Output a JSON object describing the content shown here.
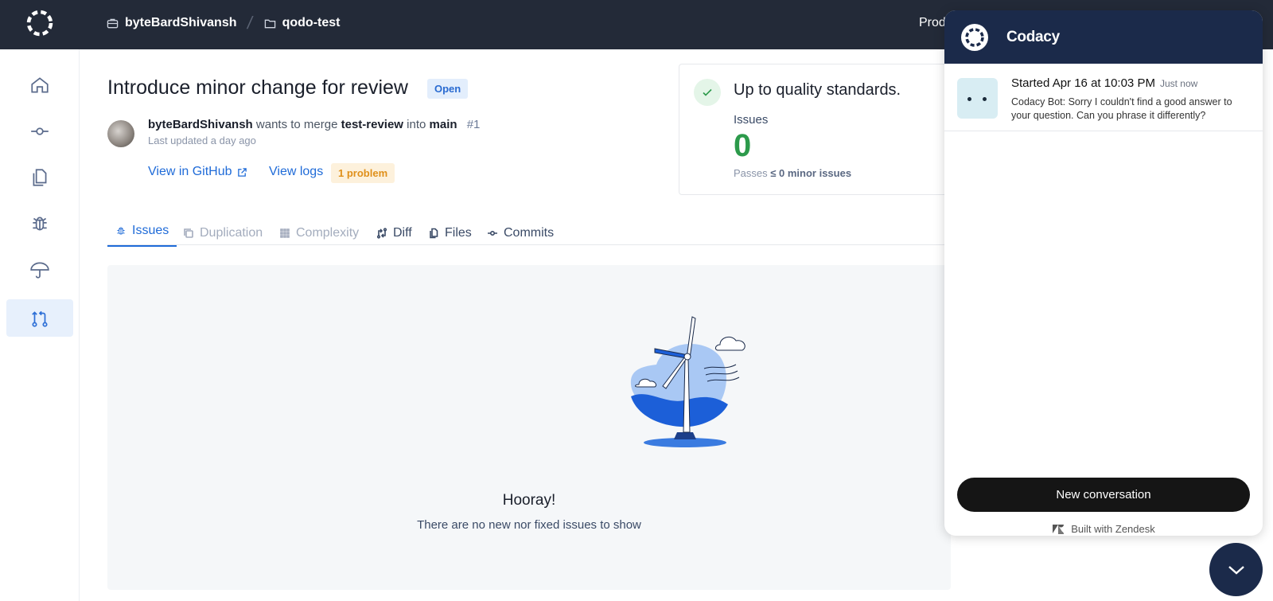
{
  "topbar": {
    "org": "byteBardShivansh",
    "repo": "qodo-test",
    "nav_partial": "Prod"
  },
  "sidebar": {
    "items": [
      {
        "icon": "home-icon"
      },
      {
        "icon": "commit-icon"
      },
      {
        "icon": "files-icon"
      },
      {
        "icon": "bug-icon"
      },
      {
        "icon": "umbrella-icon"
      },
      {
        "icon": "pull-request-icon",
        "active": true
      }
    ]
  },
  "pr": {
    "title": "Introduce minor change for review",
    "status": "Open",
    "author": "byteBardShivansh",
    "wants_to_merge": "wants to merge",
    "source_branch": "test-review",
    "into": "into",
    "target_branch": "main",
    "number": "#1",
    "updated": "Last updated a day ago",
    "github_link": "View in GitHub",
    "logs_link": "View logs",
    "problem_badge": "1 problem"
  },
  "quality": {
    "title": "Up to quality standards.",
    "issues_label": "Issues",
    "issues_count": "0",
    "passes_prefix": "Passes",
    "passes_value": "≤ 0 minor issues"
  },
  "tabs": [
    {
      "label": "Issues",
      "state": "active"
    },
    {
      "label": "Duplication",
      "state": "disabled"
    },
    {
      "label": "Complexity",
      "state": "disabled"
    },
    {
      "label": "Diff",
      "state": "normal"
    },
    {
      "label": "Files",
      "state": "normal"
    },
    {
      "label": "Commits",
      "state": "normal"
    }
  ],
  "empty_state": {
    "title": "Hooray!",
    "subtitle": "There are no new nor fixed issues to show"
  },
  "chat": {
    "brand": "Codacy",
    "conversation": {
      "title": "Started Apr 16 at 10:03 PM",
      "time": "Just now",
      "message": "Codacy Bot: Sorry I couldn't find a good answer to your question. Can you phrase it differently?"
    },
    "new_conversation": "New conversation",
    "footer": "Built with Zendesk"
  },
  "colors": {
    "topbar": "#232a38",
    "accent": "#1f6bd8",
    "success": "#2c9a4b",
    "chat_header": "#1b2a4a"
  }
}
